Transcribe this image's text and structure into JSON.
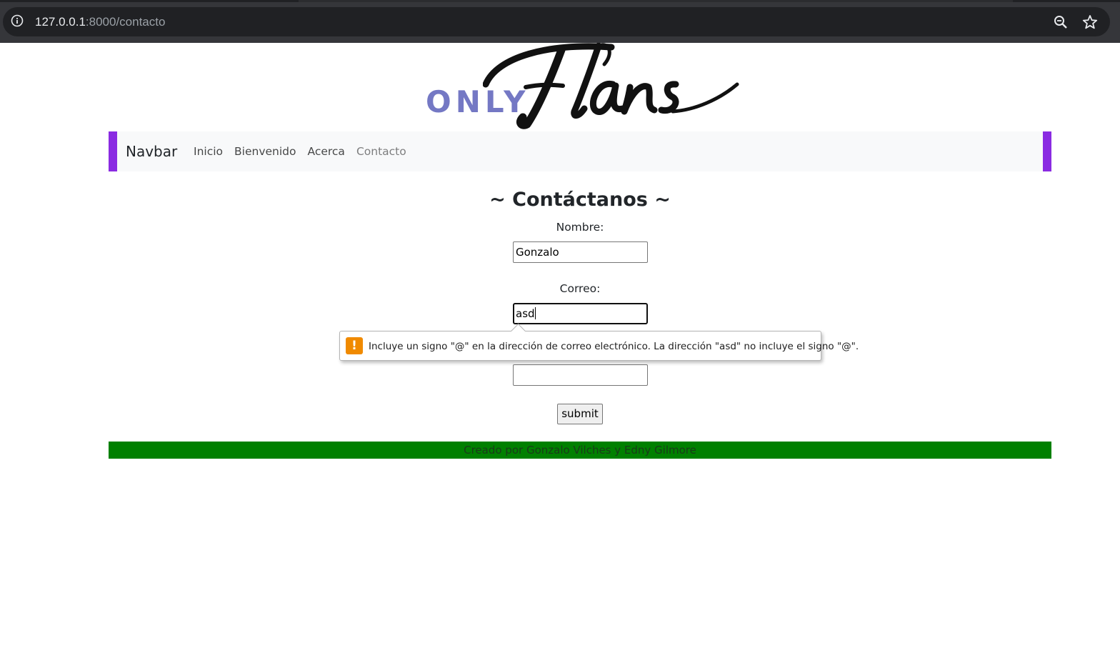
{
  "browser": {
    "url_host": "127.0.0.1",
    "url_rest": ":8000/contacto",
    "icons": [
      "site-info-icon",
      "zoom-icon",
      "bookmark-star-icon"
    ]
  },
  "logo": {
    "prefix": "ONLY",
    "script": "Flans",
    "prefix_color": "#7478c4"
  },
  "navbar": {
    "brand": "Navbar",
    "links": [
      "Inicio",
      "Bienvenido",
      "Acerca",
      "Contacto"
    ],
    "active": "Contacto",
    "accent_color": "#8a2be2"
  },
  "form": {
    "title": "~ Contáctanos ~",
    "nombre_label": "Nombre:",
    "nombre_value": "Gonzalo",
    "correo_label": "Correo:",
    "correo_value": "asd",
    "third_value": "",
    "submit_label": "submit"
  },
  "validation": {
    "message": "Incluye un signo \"@\" en la dirección de correo electrónico. La dirección \"asd\" no incluye el signo \"@\".",
    "icon": "!",
    "icon_color": "#f08a00"
  },
  "footer": {
    "text": "Creado por Gonzalo Vilches y Edny Gilmore",
    "background": "#008000"
  }
}
